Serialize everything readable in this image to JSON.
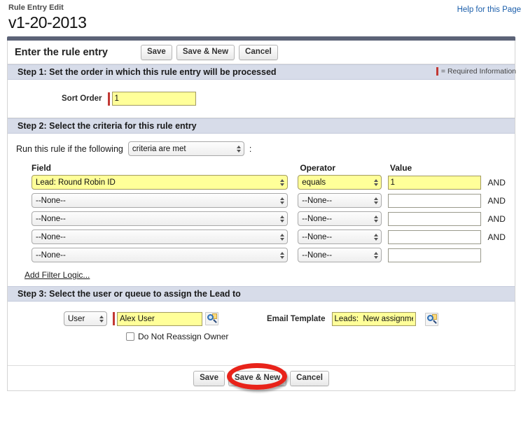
{
  "header": {
    "eyebrow": "Rule Entry Edit",
    "title": "v1-20-2013",
    "help_link": "Help for this Page"
  },
  "form": {
    "title": "Enter the rule entry",
    "buttons": {
      "save": "Save",
      "save_and_new": "Save & New",
      "cancel": "Cancel"
    }
  },
  "step1": {
    "heading": "Step 1: Set the order in which this rule entry will be processed",
    "required_legend": "= Required Information",
    "sort_order_label": "Sort Order",
    "sort_order_value": "1"
  },
  "step2": {
    "heading": "Step 2: Select the criteria for this rule entry",
    "run_rule_label": "Run this rule if the following",
    "criteria_select_value": "criteria are met",
    "colon": ":",
    "columns": {
      "field": "Field",
      "operator": "Operator",
      "value": "Value"
    },
    "rows": [
      {
        "field": "Lead: Round Robin ID",
        "operator": "equals",
        "value": "1",
        "conjunction": "AND",
        "highlighted": true
      },
      {
        "field": "--None--",
        "operator": "--None--",
        "value": "",
        "conjunction": "AND",
        "highlighted": false
      },
      {
        "field": "--None--",
        "operator": "--None--",
        "value": "",
        "conjunction": "AND",
        "highlighted": false
      },
      {
        "field": "--None--",
        "operator": "--None--",
        "value": "",
        "conjunction": "AND",
        "highlighted": false
      },
      {
        "field": "--None--",
        "operator": "--None--",
        "value": "",
        "conjunction": "",
        "highlighted": false
      }
    ],
    "add_filter_logic": "Add Filter Logic..."
  },
  "step3": {
    "heading": "Step 3: Select the user or queue to assign the Lead to",
    "assignee_type": "User",
    "assignee_value": "Alex User",
    "do_not_reassign_label": "Do Not Reassign Owner",
    "do_not_reassign_checked": false,
    "email_template_label": "Email Template",
    "email_template_value": "Leads:  New assignme"
  },
  "footer": {
    "save": "Save",
    "save_and_new": "Save & New",
    "cancel": "Cancel"
  },
  "colors": {
    "required_marker": "#c23934",
    "required_field_bg": "#ffff99",
    "step_header_bg": "#d7dce9",
    "panel_topbar": "#5c6377",
    "link": "#1c5fab",
    "annotation": "#e8231a"
  }
}
